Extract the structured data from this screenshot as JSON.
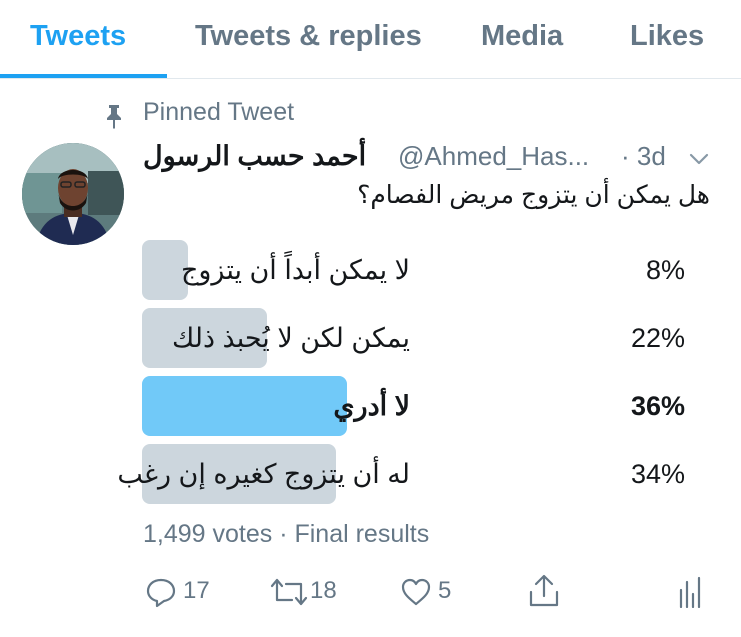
{
  "tabs": [
    {
      "label": "Tweets",
      "active": true
    },
    {
      "label": "Tweets & replies",
      "active": false
    },
    {
      "label": "Media",
      "active": false
    },
    {
      "label": "Likes",
      "active": false
    }
  ],
  "tweet": {
    "pinned_label": "Pinned Tweet",
    "author_name": "أحمد حسب الرسول",
    "handle": "@Ahmed_Has...",
    "time": "· 3d",
    "text": "هل يمكن أن يتزوج مريض الفصام؟"
  },
  "poll": {
    "options": [
      {
        "label": "لا يمكن أبداً أن يتزوج",
        "percent": "8%",
        "fraction": 0.08,
        "winner": false
      },
      {
        "label": "يمكن لكن لا يُحبذ ذلك",
        "percent": "22%",
        "fraction": 0.22,
        "winner": false
      },
      {
        "label": "لا أدري",
        "percent": "36%",
        "fraction": 0.36,
        "winner": true
      },
      {
        "label": "له أن يتزوج كغيره إن رغب",
        "percent": "34%",
        "fraction": 0.34,
        "winner": false
      }
    ],
    "summary": "1,499 votes · Final results"
  },
  "actions": {
    "reply_count": "17",
    "retweet_count": "18",
    "like_count": "5"
  },
  "colors": {
    "accent": "#1da1f2",
    "winner_bar": "#71c9f8",
    "bar": "#ccd6dd",
    "secondary_text": "#657786"
  },
  "icons": [
    "pin-icon",
    "chevron-down-icon",
    "reply-icon",
    "retweet-icon",
    "like-icon",
    "share-icon",
    "analytics-icon"
  ]
}
